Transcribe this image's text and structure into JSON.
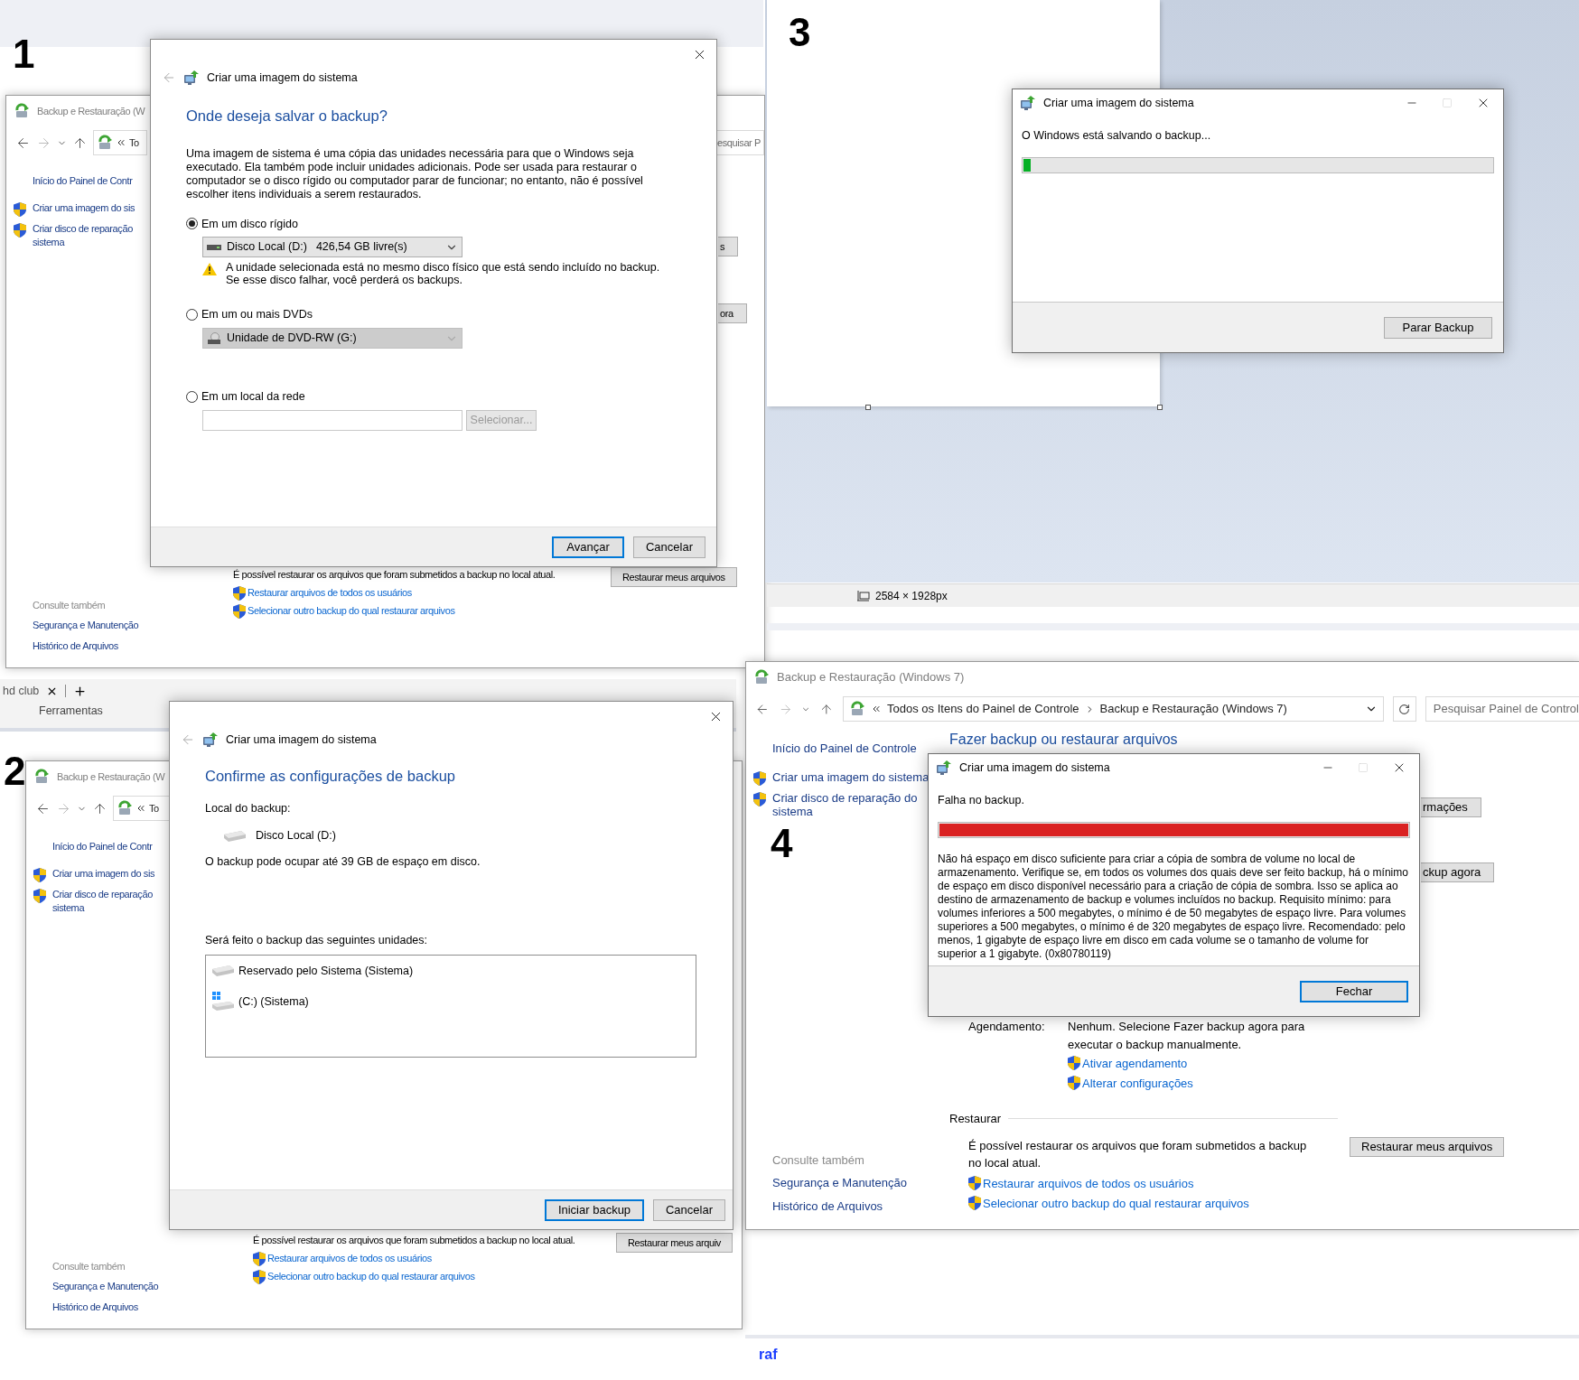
{
  "panel_1": {
    "label": "1",
    "window": {
      "title": "Backup e Restauração (W",
      "address": [
        "To"
      ],
      "search": "esquisar P",
      "home_link": "Início do Painel de Contr",
      "tasks": [
        {
          "lines": [
            "Criar uma imagem do sis"
          ]
        },
        {
          "lines": [
            "Criar disco de reparação",
            "sistema"
          ]
        }
      ],
      "right_buttons": [
        "s",
        "ora"
      ],
      "see_also": {
        "title": "Consulte também",
        "links": [
          "Segurança e Manutenção",
          "Histórico de Arquivos"
        ]
      },
      "restore": {
        "text": "É possível restaurar os arquivos que foram submetidos a backup no local atual.",
        "button": "Restaurar meus arquivos",
        "links": [
          "Restaurar arquivos de todos os usuários",
          "Selecionar outro backup do qual restaurar arquivos"
        ]
      }
    },
    "dialog": {
      "title": "Criar uma imagem do sistema",
      "heading": "Onde deseja salvar o backup?",
      "description": "Uma imagem de sistema é uma cópia das unidades necessária para que o Windows seja executado. Ela também pode incluir unidades adicionais. Pode ser usada para restaurar o computador se o disco rígido ou computador parar de funcionar; no entanto, não é possível escolher itens individuais a serem restaurados.",
      "options": [
        {
          "kind": "hdd",
          "label": "Em um disco rígido",
          "selected": true,
          "dropdown": {
            "drive": "Disco Local (D:)",
            "free": "426,54 GB livre(s)",
            "disabled": false
          },
          "warning": "A unidade selecionada está no mesmo disco físico que está sendo incluído no backup. Se esse disco falhar, você perderá os backups."
        },
        {
          "kind": "dvd",
          "label": "Em um ou mais DVDs",
          "selected": false,
          "dropdown": {
            "drive": "Unidade de DVD-RW (G:)",
            "disabled": true
          }
        },
        {
          "kind": "network",
          "label": "Em um local da rede",
          "selected": false,
          "button": {
            "label": "Selecionar...",
            "disabled": true
          }
        }
      ],
      "buttons": [
        {
          "label": "Avançar",
          "default": true
        },
        {
          "label": "Cancelar",
          "default": false
        }
      ]
    }
  },
  "panel_2": {
    "label": "2",
    "toolbar": {
      "tab": "hd club",
      "group": "Ferramentas"
    },
    "window": {
      "title": "Backup e Restauração (W",
      "address": [
        "To"
      ],
      "home_link": "Início do Painel de Contr",
      "tasks": [
        {
          "lines": [
            "Criar uma imagem do sis"
          ]
        },
        {
          "lines": [
            "Criar disco de reparação",
            "sistema"
          ]
        }
      ],
      "see_also": {
        "title": "Consulte também",
        "links": [
          "Segurança e Manutenção",
          "Histórico de Arquivos"
        ]
      },
      "restore": {
        "text": "É possível restaurar os arquivos que foram submetidos a backup no local atual.",
        "button": "Restaurar meus arquiv",
        "links": [
          "Restaurar arquivos de todos os usuários",
          "Selecionar outro backup do qual restaurar arquivos"
        ]
      }
    },
    "dialog": {
      "title": "Criar uma imagem do sistema",
      "heading": "Confirme as configurações de backup",
      "location_label": "Local do backup:",
      "location": "Disco Local (D:)",
      "size_note": "O backup pode ocupar até 39 GB de espaço em disco.",
      "drives_label": "Será feito o backup das seguintes unidades:",
      "drives": [
        {
          "kind": "hdd",
          "label": "Reservado pelo Sistema (Sistema)"
        },
        {
          "kind": "windows",
          "label": "(C:) (Sistema)"
        }
      ],
      "buttons": [
        {
          "label": "Iniciar backup",
          "default": true
        },
        {
          "label": "Cancelar",
          "default": false
        }
      ]
    }
  },
  "panel_3": {
    "label": "3",
    "dialog": {
      "title": "Criar uma imagem do sistema",
      "message": "O Windows está salvando o backup...",
      "progress": {
        "level": 0.015,
        "failed": false
      },
      "buttons": [
        {
          "label": "Parar Backup",
          "default": false
        }
      ]
    },
    "status_bar": {
      "dimensions": "2584 × 1928px"
    }
  },
  "panel_4": {
    "label": "4",
    "window": {
      "title": "Backup e Restauração (Windows 7)",
      "address": [
        "Todos os Itens do Painel de Controle",
        "Backup e Restauração (Windows 7)"
      ],
      "search": "Pesquisar Painel de Control",
      "home_link": "Início do Painel de Controle",
      "tasks": [
        {
          "lines": [
            "Criar uma imagem do sistema"
          ]
        },
        {
          "lines": [
            "Criar disco de reparação do",
            "sistema"
          ]
        }
      ],
      "heading": "Fazer backup ou restaurar arquivos",
      "right_buttons": [
        "rmações",
        "ckup agora"
      ],
      "schedule": {
        "label": "Agendamento:",
        "value": "Nenhum. Selecione Fazer backup agora para executar o backup manualmente.",
        "links": [
          "Ativar agendamento",
          "Alterar configurações"
        ]
      },
      "see_also": {
        "title": "Consulte também",
        "links": [
          "Segurança e Manutenção",
          "Histórico de Arquivos"
        ]
      },
      "restore": {
        "title": "Restaurar",
        "text": "É possível restaurar os arquivos que foram submetidos a backup no local atual.",
        "button": "Restaurar meus arquivos",
        "links": [
          "Restaurar arquivos de todos os usuários",
          "Selecionar outro backup do qual restaurar arquivos"
        ]
      }
    },
    "dialog": {
      "title": "Criar uma imagem do sistema",
      "message": "Falha no backup.",
      "progress": {
        "level": 1,
        "failed": true
      },
      "error": "Não há espaço em disco suficiente para criar a cópia de sombra de volume no local de armazenamento. Verifique se, em todos os volumes dos quais deve ser feito backup, há o mínimo de espaço em disco disponível necessário para a criação de cópia de sombra. Isso se aplica ao destino de armazenamento de backup e volumes incluídos no backup. Requisito mínimo: para volumes inferiores a 500 megabytes, o mínimo é de 50 megabytes de espaço livre. Para volumes superiores a 500 megabytes, o mínimo é de 320 megabytes de espaço livre.  Recomendado: pelo menos, 1 gigabyte de espaço livre em disco em cada volume se o tamanho de volume for superior a 1 gigabyte. (0x80780119)",
      "buttons": [
        {
          "label": "Fechar",
          "default": true
        }
      ]
    },
    "footer_text": "raf"
  }
}
